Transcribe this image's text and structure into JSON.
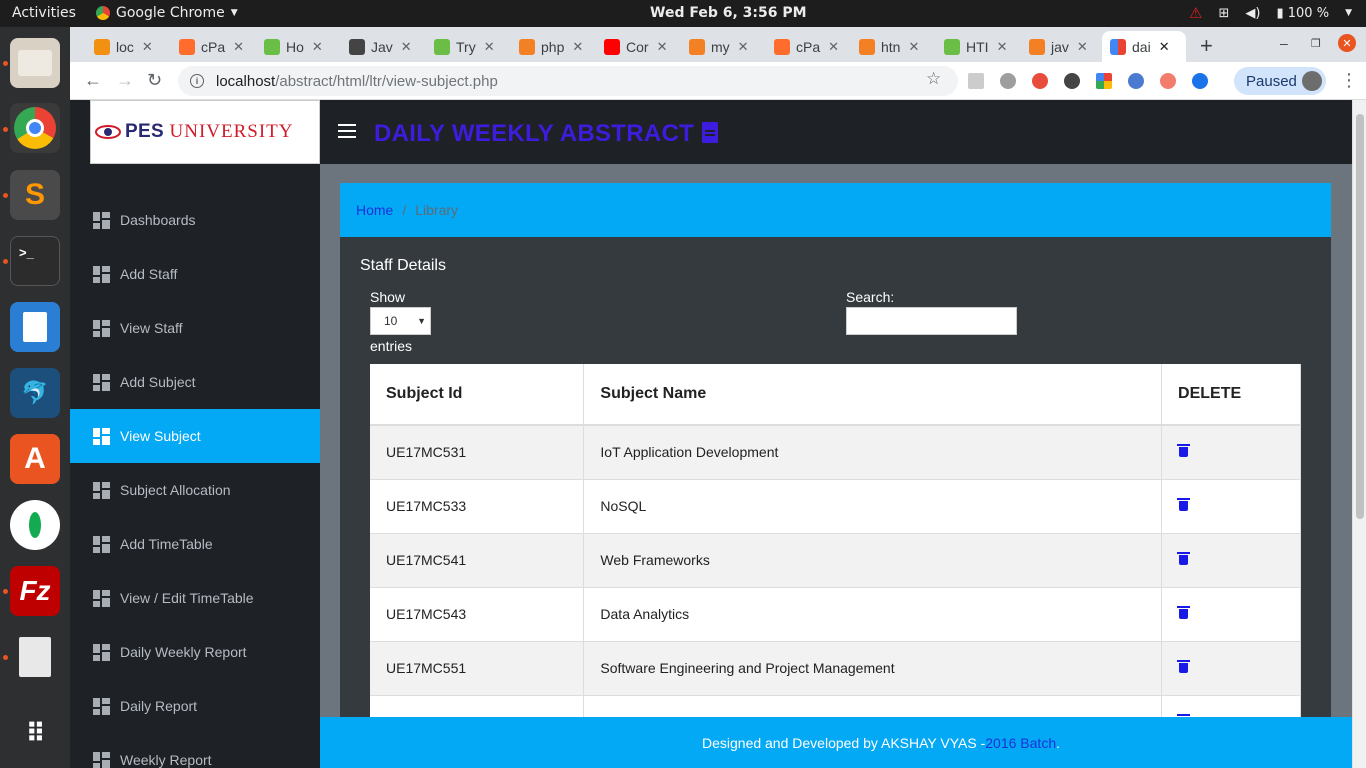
{
  "os": {
    "activities": "Activities",
    "app_menu": "Google Chrome",
    "clock": "Wed Feb  6,  3:56 PM",
    "battery": "100 %"
  },
  "browser": {
    "tabs": [
      {
        "label": "loc",
        "color": "#f29111"
      },
      {
        "label": "cPa",
        "color": "#ff6c2c"
      },
      {
        "label": "Ho",
        "color": "#6bbe45"
      },
      {
        "label": "Jav",
        "color": "#444444"
      },
      {
        "label": "Try",
        "color": "#6bbe45"
      },
      {
        "label": "php",
        "color": "#f48024"
      },
      {
        "label": "Cor",
        "color": "#ff0000"
      },
      {
        "label": "my",
        "color": "#f48024"
      },
      {
        "label": "cPa",
        "color": "#ff6c2c"
      },
      {
        "label": "htn",
        "color": "#f48024"
      },
      {
        "label": "HTI",
        "color": "#6bbe45"
      },
      {
        "label": "jav",
        "color": "#f48024"
      },
      {
        "label": "dai",
        "color": "#4285f4"
      }
    ],
    "url_host": "localhost",
    "url_path": "/abstract/html/ltr/view-subject.php",
    "profile_label": "Paused"
  },
  "site": {
    "logo_pes": "PES",
    "logo_university": "UNIVERSITY",
    "title": "DAILY WEEKLY ABSTRACT"
  },
  "sidebar": {
    "items": [
      {
        "label": "Dashboards"
      },
      {
        "label": "Add Staff"
      },
      {
        "label": "View Staff"
      },
      {
        "label": "Add Subject"
      },
      {
        "label": "View Subject"
      },
      {
        "label": "Subject Allocation"
      },
      {
        "label": "Add TimeTable"
      },
      {
        "label": "View / Edit TimeTable"
      },
      {
        "label": "Daily Weekly Report"
      },
      {
        "label": "Daily Report"
      },
      {
        "label": "Weekly Report"
      }
    ],
    "active_index": 4
  },
  "breadcrumb": {
    "home": "Home",
    "separator": "/",
    "current": "Library"
  },
  "card": {
    "title": "Staff Details",
    "show_label": "Show",
    "entries_value": "10",
    "entries_label": "entries",
    "search_label": "Search:"
  },
  "table": {
    "headers": [
      "Subject Id",
      "Subject Name",
      "DELETE"
    ],
    "rows": [
      {
        "id": "UE17MC531",
        "name": "IoT Application Development"
      },
      {
        "id": "UE17MC533",
        "name": "NoSQL"
      },
      {
        "id": "UE17MC541",
        "name": "Web Frameworks"
      },
      {
        "id": "UE17MC543",
        "name": "Data Analytics"
      },
      {
        "id": "UE17MC551",
        "name": "Software Engineering and Project Management"
      }
    ]
  },
  "footer": {
    "text": "Designed and Developed by AKSHAY VYAS -",
    "link": "2016 Batch",
    "suffix": "."
  },
  "colors": {
    "accent": "#03a9f4",
    "header_bg": "#1e2126",
    "title": "#3d1cde",
    "delete_icon": "#1a1ae6"
  }
}
